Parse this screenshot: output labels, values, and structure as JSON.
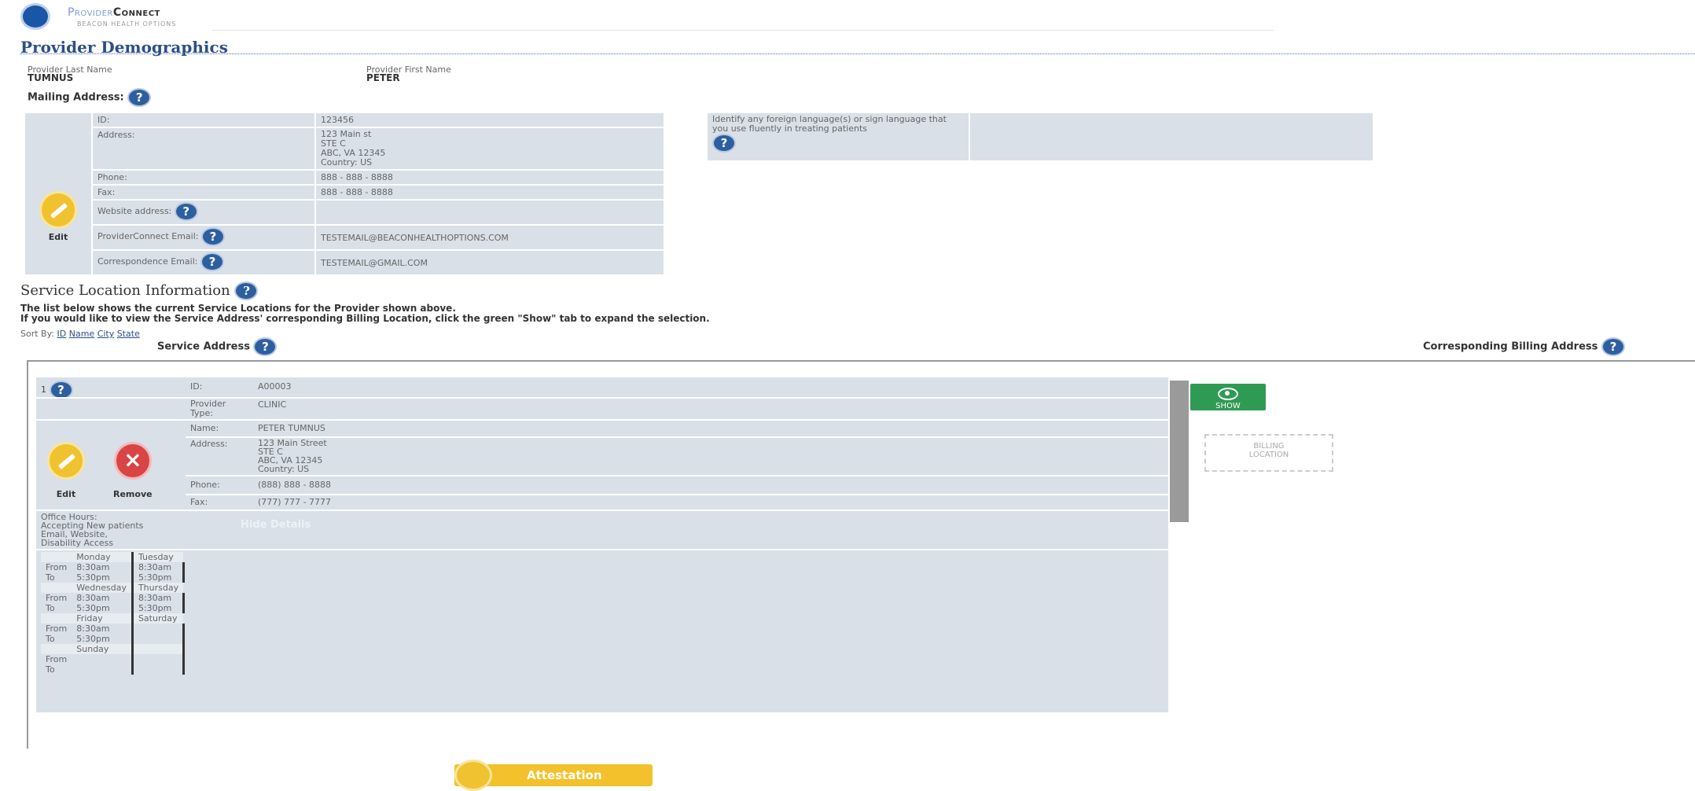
{
  "logo": {
    "brand": "ProviderConnect",
    "brand_first": "Provider",
    "brand_second": "Connect",
    "subtitle": "BEACON HEALTH OPTIONS"
  },
  "demographics": {
    "title": "Provider Demographics",
    "last_name_label": "Provider Last Name",
    "last_name": "TUMNUS",
    "first_name_label": "Provider First Name",
    "first_name": "PETER",
    "mailing_label": "Mailing Address:",
    "edit_label": "Edit",
    "rows": [
      {
        "label": "ID:",
        "value": "123456"
      },
      {
        "label": "Address:",
        "value": "123 Main st\nSTE C\nABC, VA 12345\nCountry: US"
      },
      {
        "label": "Phone:",
        "value": "888 - 888 - 8888"
      },
      {
        "label": "Fax:",
        "value": "888 - 888 - 8888"
      },
      {
        "label": "Website address:",
        "value": ""
      },
      {
        "label": "ProviderConnect Email:",
        "value": "TESTEMAIL@BEACONHEALTHOPTIONS.COM"
      },
      {
        "label": "Correspondence Email:",
        "value": "TESTEMAIL@GMAIL.COM"
      }
    ],
    "language_prompt": "Identify any foreign language(s) or sign language that you use fluently in treating patients",
    "language_value": ""
  },
  "service": {
    "title": "Service Location Information",
    "line1": "The list below shows the current Service Locations for the Provider shown above.",
    "line2": "If you would like to view the Service Address' corresponding Billing Location, click the green \"Show\" tab to expand the selection.",
    "sort_label": "Sort By:",
    "sort_options": [
      "ID",
      "Name",
      "City",
      "State"
    ],
    "service_address_header": "Service Address",
    "billing_address_header": "Corresponding Billing Address",
    "location": {
      "index": "1",
      "id_label": "ID:",
      "id": "A00003",
      "type_label": "Provider Type:",
      "type": "CLINIC",
      "name_label": "Name:",
      "name": "PETER TUMNUS",
      "address_label": "Address:",
      "address": "123 Main Street\nSTE C\nABC, VA 12345\nCountry: US",
      "phone_label": "Phone:",
      "phone": "(888) 888 - 8888",
      "fax_label": "Fax:",
      "fax": "(777) 777 - 7777",
      "edit_label": "Edit",
      "remove_label": "Remove",
      "details_text": "Office Hours:\nAccepting New patients\nEmail, Website,\nDisability Access",
      "hide_details": "Hide Details",
      "hours": {
        "from_label": "From",
        "to_label": "To",
        "days": [
          {
            "day": "Monday",
            "from": "8:30am",
            "to": "5:30pm"
          },
          {
            "day": "Tuesday",
            "from": "8:30am",
            "to": "5:30pm"
          },
          {
            "day": "Wednesday",
            "from": "8:30am",
            "to": "5:30pm"
          },
          {
            "day": "Thursday",
            "from": "8:30am",
            "to": "5:30pm"
          },
          {
            "day": "Friday",
            "from": "8:30am",
            "to": "5:30pm"
          },
          {
            "day": "Saturday",
            "from": "",
            "to": ""
          },
          {
            "day": "Sunday",
            "from": "",
            "to": ""
          }
        ]
      }
    },
    "show_label": "SHOW",
    "billing_placeholder": "BILLING LOCATION"
  },
  "attestation_label": "Attestation"
}
